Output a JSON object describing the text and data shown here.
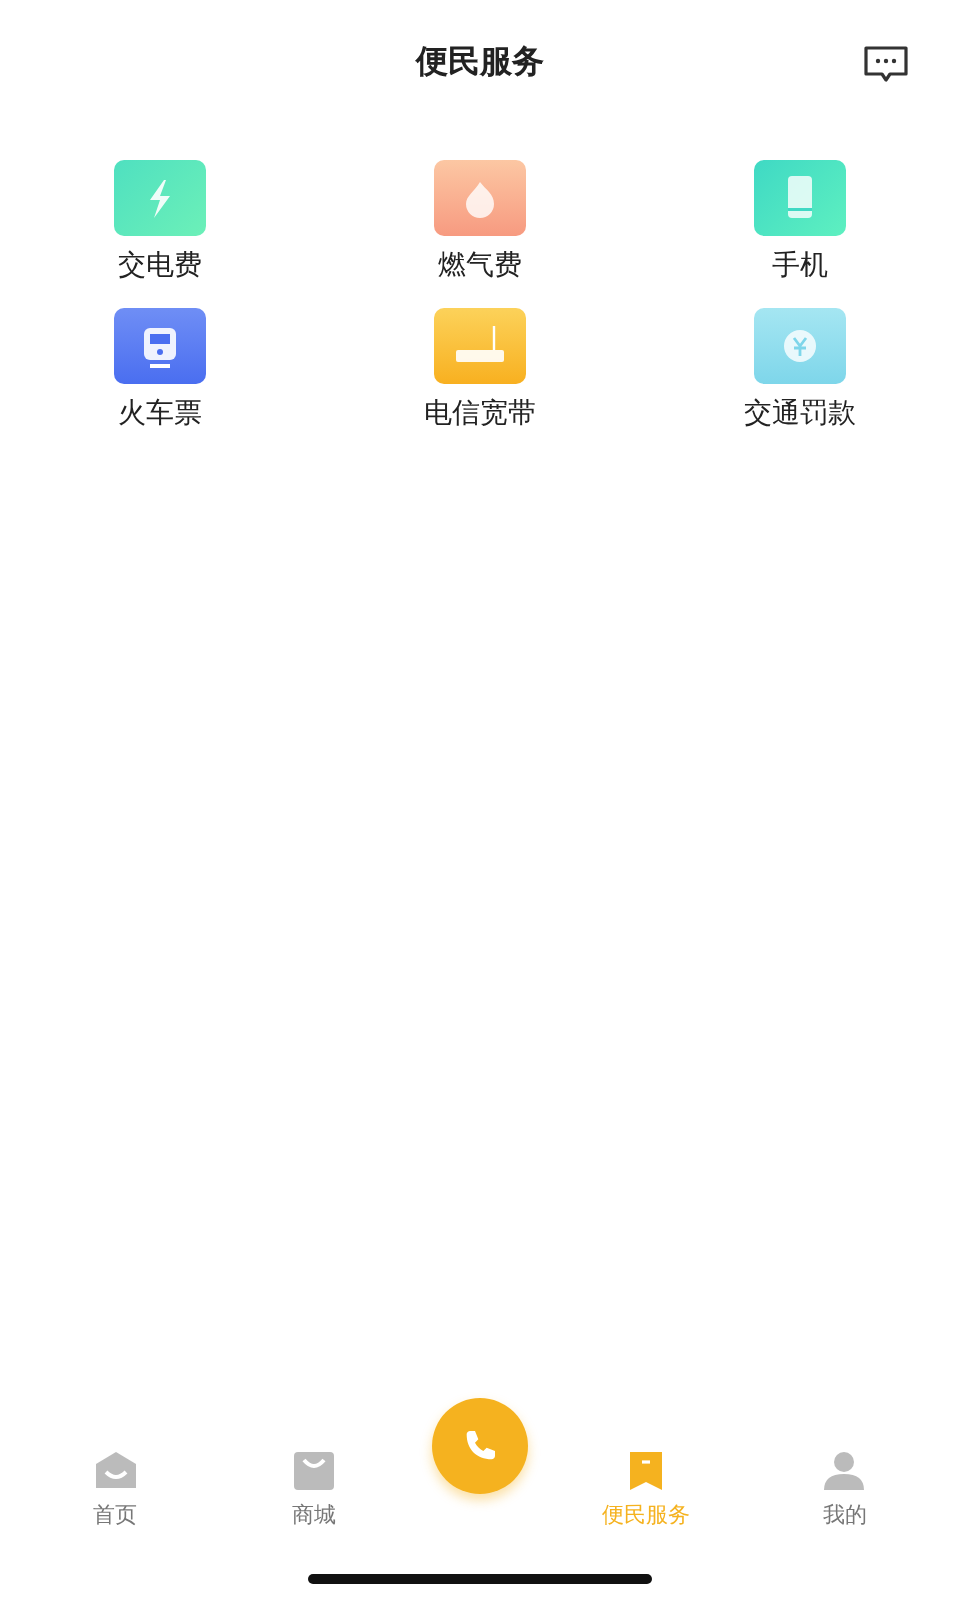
{
  "header": {
    "title": "便民服务"
  },
  "services": [
    {
      "label": "交电费",
      "kind": "power"
    },
    {
      "label": "燃气费",
      "kind": "gas"
    },
    {
      "label": "手机",
      "kind": "phone"
    },
    {
      "label": "火车票",
      "kind": "train"
    },
    {
      "label": "电信宽带",
      "kind": "router"
    },
    {
      "label": "交通罚款",
      "kind": "fine"
    }
  ],
  "tabbar": [
    {
      "label": "首页",
      "kind": "home",
      "selected": false
    },
    {
      "label": "商城",
      "kind": "shop",
      "selected": false
    },
    {
      "kind": "call",
      "selected": false
    },
    {
      "label": "便民服务",
      "kind": "service",
      "selected": true
    },
    {
      "label": "我的",
      "kind": "user",
      "selected": false
    }
  ]
}
